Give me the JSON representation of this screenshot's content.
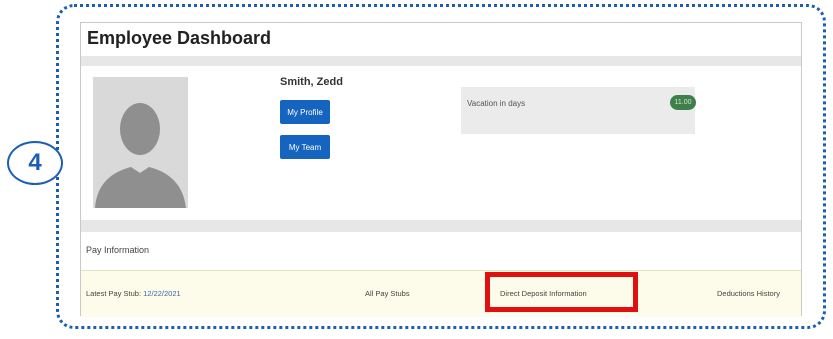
{
  "step_number": "4",
  "dashboard": {
    "title": "Employee Dashboard",
    "employee_name": "Smith, Zedd",
    "buttons": {
      "my_profile": "My Profile",
      "my_team": "My Team"
    },
    "vacation": {
      "label": "Vacation in days",
      "value": "11.00"
    }
  },
  "pay": {
    "section_title": "Pay Information",
    "latest_stub_label": "Latest Pay Stub:",
    "latest_stub_date": "12/22/2021",
    "all_pay_stubs": "All Pay Stubs",
    "direct_deposit": "Direct Deposit Information",
    "deductions_history": "Deductions History"
  },
  "colors": {
    "frame": "#1a5fb4",
    "button": "#1565c0",
    "highlight": "#e01010",
    "vacation_badge": "#3f7f4a",
    "pay_row_bg": "#fdfbe9"
  }
}
